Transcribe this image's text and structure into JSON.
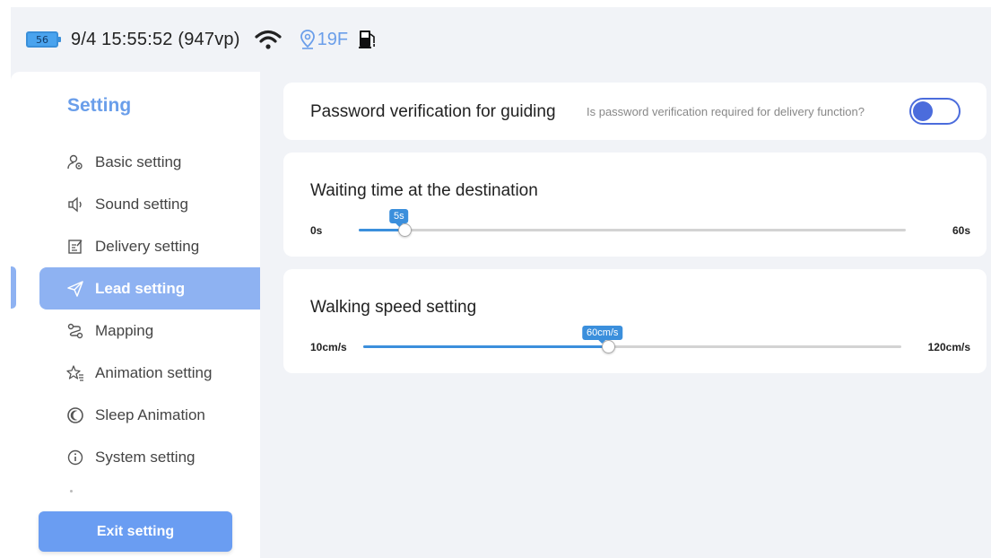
{
  "status": {
    "battery": "56",
    "datetime": "9/4 15:55:52 (947vp)",
    "floor": "19F",
    "icons": [
      "battery-icon",
      "wifi-icon",
      "location-pin-icon",
      "fuel-pump-icon"
    ]
  },
  "sidebar": {
    "title": "Setting",
    "items": [
      {
        "label": "Basic setting",
        "icon": "user-gear-icon"
      },
      {
        "label": "Sound setting",
        "icon": "speaker-icon"
      },
      {
        "label": "Delivery setting",
        "icon": "clipboard-edit-icon"
      },
      {
        "label": "Lead setting",
        "icon": "send-icon",
        "active": true
      },
      {
        "label": "Mapping",
        "icon": "route-icon"
      },
      {
        "label": "Animation setting",
        "icon": "star-list-icon"
      },
      {
        "label": "Sleep Animation",
        "icon": "moon-icon"
      },
      {
        "label": "System setting",
        "icon": "info-icon"
      }
    ],
    "exit_label": "Exit setting"
  },
  "password": {
    "title": "Password verification for guiding",
    "hint": "Is password verification required for delivery function?",
    "enabled": false
  },
  "waiting": {
    "title": "Waiting time at the destination",
    "min_label": "0s",
    "max_label": "60s",
    "value_label": "5s",
    "min": 0,
    "max": 60,
    "value": 5
  },
  "speed": {
    "title": "Walking speed setting",
    "min_label": "10cm/s",
    "max_label": "120cm/s",
    "value_label": "60cm/s",
    "min": 10,
    "max": 120,
    "value": 60
  },
  "colors": {
    "accent": "#6a9eea",
    "slider": "#3b8fdc",
    "toggle": "#4b6cdc",
    "active_item": "#8eb2f2"
  }
}
